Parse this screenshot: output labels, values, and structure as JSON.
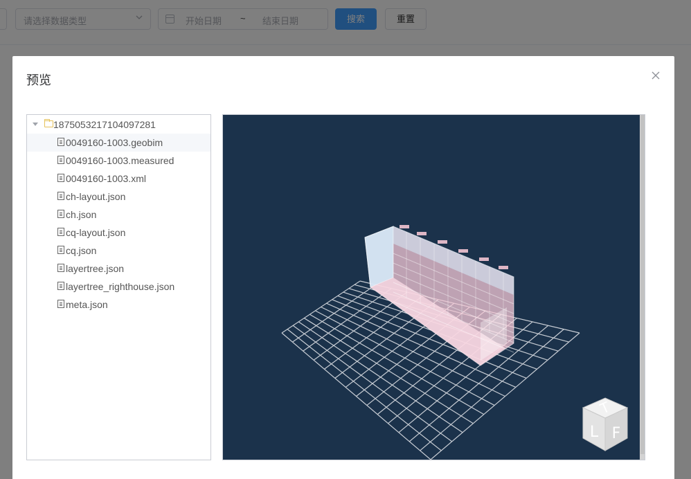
{
  "background": {
    "type_select_placeholder": "请选择数据类型",
    "start_date_placeholder": "开始日期",
    "range_separator": "~",
    "end_date_placeholder": "结束日期",
    "search_label": "搜索",
    "reset_label": "重置"
  },
  "dialog": {
    "title": "预览"
  },
  "tree": {
    "root": {
      "label": "1875053217104097281",
      "expanded": true
    },
    "files": [
      {
        "label": "0049160-1003.geobim",
        "selected": true
      },
      {
        "label": "0049160-1003.measured",
        "selected": false
      },
      {
        "label": "0049160-1003.xml",
        "selected": false
      },
      {
        "label": "ch-layout.json",
        "selected": false
      },
      {
        "label": "ch.json",
        "selected": false
      },
      {
        "label": "cq-layout.json",
        "selected": false
      },
      {
        "label": "cq.json",
        "selected": false
      },
      {
        "label": "layertree.json",
        "selected": false
      },
      {
        "label": "layertree_righthouse.json",
        "selected": false
      },
      {
        "label": "meta.json",
        "selected": false
      }
    ]
  },
  "viewer": {
    "background_color": "#1b324b",
    "grid_color": "#c8cdd4",
    "model_color_pink": "#f6c8d6",
    "model_color_blue": "#d6ecfa",
    "viewcube": {
      "top_letter": "T",
      "left_letter": "L",
      "right_letter": "F"
    }
  }
}
